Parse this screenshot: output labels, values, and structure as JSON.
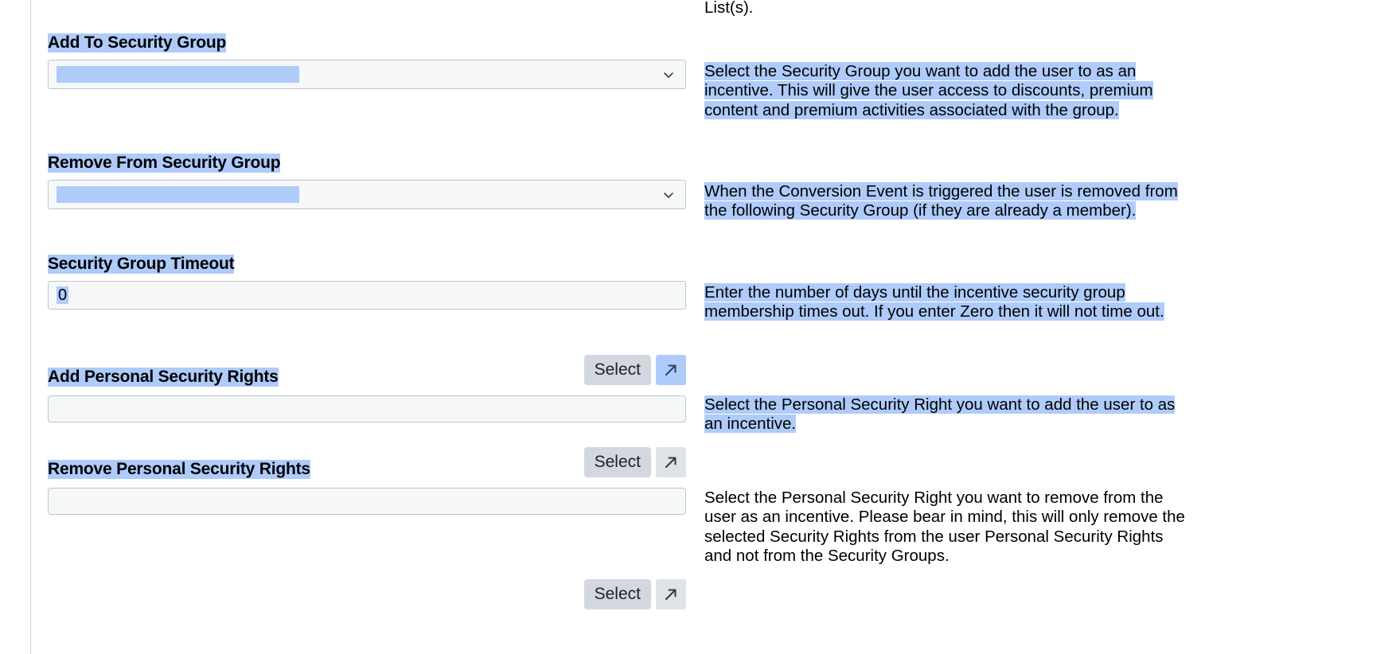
{
  "colors": {
    "selection_highlight": "#aecbfa",
    "field_border": "#b9c6cf",
    "field_background": "#f6f8f8",
    "button_background": "#d3d8e0",
    "arrow_button_background": "#dfe3e6",
    "rule": "#c8cdd2"
  },
  "top_fragment": {
    "text": "List(s)."
  },
  "fields": [
    {
      "id": "add-to-security-group",
      "label": "Add To Security Group",
      "control": "select",
      "value": "",
      "chevron_icon": "chevron-down-icon",
      "help": "Select the Security Group you want to add the user to as an incentive. This will give the user access to discounts, premium content and premium activities associated with the group.",
      "help_highlighted": true,
      "label_highlighted": true
    },
    {
      "id": "remove-from-security-group",
      "label": "Remove From Security Group",
      "control": "select",
      "value": "",
      "chevron_icon": "chevron-down-icon",
      "help": "When the Conversion Event is triggered the user is removed from the following Security Group (if they are already a member).",
      "help_highlighted": true,
      "label_highlighted": true
    },
    {
      "id": "security-group-timeout",
      "label": "Security Group Timeout",
      "control": "text",
      "value": "0",
      "help": "Enter the number of days until the incentive security group membership times out. If you enter Zero then it will not time out.",
      "help_highlighted": true,
      "label_highlighted": true
    },
    {
      "id": "add-personal-security-rights",
      "label": "Add Personal Security Rights",
      "control": "picker",
      "value": "",
      "button_label": "Select",
      "arrow_icon": "arrow-up-right-icon",
      "arrow_highlighted": true,
      "help": "Select the Personal Security Right you want to add the user to as an incentive.",
      "help_highlighted": true,
      "label_highlighted": true
    },
    {
      "id": "remove-personal-security-rights",
      "label": "Remove Personal Security Rights",
      "control": "picker",
      "value": "",
      "button_label": "Select",
      "arrow_icon": "arrow-up-right-icon",
      "arrow_highlighted": false,
      "help": "Select the Personal Security Right you want to remove from the user as an incentive. Please bear in mind, this will only remove the selected Security Rights from the user Personal Security Rights and not from the Security Groups.",
      "help_highlighted": false,
      "label_highlighted": true
    }
  ],
  "clipped_bottom": {
    "button_label": "Select",
    "arrow_icon": "arrow-up-right-icon"
  }
}
